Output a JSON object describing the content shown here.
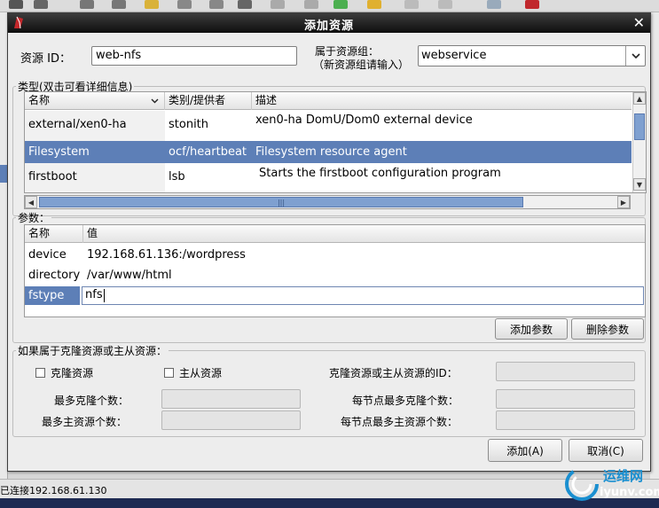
{
  "status_bar": {
    "text": "已连接192.168.61.130"
  },
  "dialog": {
    "title": "添加资源",
    "resource_id_label": "资源 ID：",
    "resource_id_value": "web-nfs",
    "group_label_line1": "属于资源组：",
    "group_label_line2": "（新资源组请输入）",
    "group_value": "webservice"
  },
  "type_section": {
    "legend": "类型(双击可看详细信息)",
    "columns": [
      "名称",
      "类别/提供者",
      "描述"
    ],
    "rows": [
      {
        "name": "external/xen0-ha",
        "provider": "stonith",
        "description": "xen0-ha DomU/Dom0 external device"
      },
      {
        "name": "Filesystem",
        "provider": "ocf/heartbeat",
        "description": "Filesystem resource agent"
      },
      {
        "name": "firstboot",
        "provider": "lsb",
        "description": "Starts the firstboot configuration program"
      }
    ],
    "selected_row": 1,
    "hscroll_grip": "|||"
  },
  "params_section": {
    "legend": "参数：",
    "columns": [
      "名称",
      "值"
    ],
    "rows": [
      {
        "name": "device",
        "value": "192.168.61.136:/wordpress"
      },
      {
        "name": "directory",
        "value": "/var/www/html"
      },
      {
        "name": "fstype",
        "value": "nfs"
      }
    ],
    "add_button": "添加参数",
    "delete_button": "删除参数"
  },
  "clone_section": {
    "legend": "如果属于克隆资源或主从资源：",
    "clone_checkbox": "克隆资源",
    "master_checkbox": "主从资源",
    "id_label": "克隆资源或主从资源的ID：",
    "max_clones_label": "最多克隆个数：",
    "max_masters_label": "最多主资源个数：",
    "max_clones_per_node_label": "每节点最多克隆个数：",
    "max_masters_per_node_label": "每节点最多主资源个数："
  },
  "footer": {
    "ok_button": "添加(A)",
    "cancel_button": "取消(C)"
  },
  "watermark": {
    "text_cn": "运维网",
    "text_en": "iyunv.com"
  },
  "colors": {
    "selection": "#5d7fb7",
    "titlebar": "#111111",
    "dialog_bg": "#ededed",
    "watermark": "#1a8fd0"
  }
}
